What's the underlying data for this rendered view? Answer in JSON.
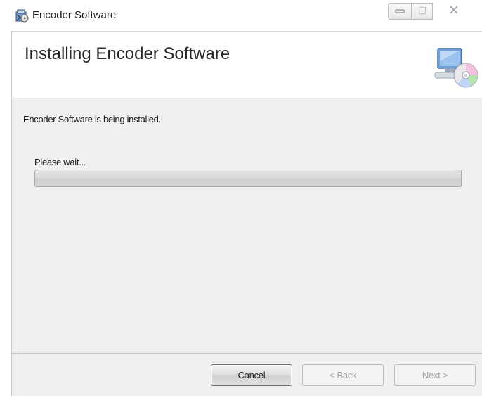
{
  "window": {
    "title": "Encoder Software",
    "caption_buttons": {
      "minimize": "—",
      "maximize": "▢",
      "close": "✕"
    }
  },
  "header": {
    "title": "Installing Encoder Software",
    "icon": "computer-cd-icon"
  },
  "body": {
    "status": "Encoder Software is being installed.",
    "wait_label": "Please wait...",
    "progress": 0
  },
  "footer": {
    "cancel_label": "Cancel",
    "back_label": "< Back",
    "next_label": "Next >"
  },
  "colors": {
    "body_background": "#f0f0f0",
    "header_background": "#ffffff"
  }
}
